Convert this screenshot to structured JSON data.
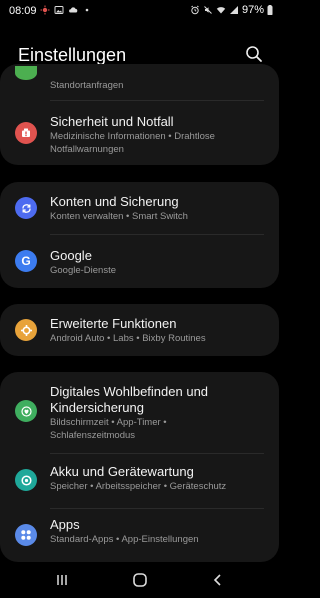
{
  "status_bar": {
    "time": "08:09",
    "battery": "97%"
  },
  "header": {
    "title": "Einstellungen"
  },
  "top_partial": {
    "subtitle": "Standortanfragen",
    "icon": "location-icon",
    "color": "#4caf50"
  },
  "items": [
    {
      "title": "Sicherheit und Notfall",
      "subtitle": "Medizinische Informationen  •  Drahtlose Notfallwarnungen",
      "icon": "emergency-icon",
      "color": "#e0534f"
    },
    {
      "title": "Konten und Sicherung",
      "subtitle": "Konten verwalten  •  Smart Switch",
      "icon": "sync-icon",
      "color": "#4d6bf0"
    },
    {
      "title": "Google",
      "subtitle": "Google-Dienste",
      "icon": "google-icon",
      "color": "#3c7cf0"
    },
    {
      "title": "Erweiterte Funktionen",
      "subtitle": "Android Auto  •  Labs  •  Bixby Routines",
      "icon": "gear-plus-icon",
      "color": "#e8a33a"
    },
    {
      "title": "Digitales Wohlbefinden und Kindersicherung",
      "subtitle": "Bildschirmzeit  •  App-Timer  •  Schlafenszeitmodus",
      "icon": "wellbeing-icon",
      "color": "#3fae5f"
    },
    {
      "title": "Akku und Gerätewartung",
      "subtitle": "Speicher  •  Arbeitsspeicher  •  Geräteschutz",
      "icon": "device-care-icon",
      "color": "#1fa89a"
    },
    {
      "title": "Apps",
      "subtitle": "Standard-Apps  •  App-Einstellungen",
      "icon": "apps-icon",
      "color": "#5a8ae8"
    }
  ],
  "nav": {
    "recents": "recents-icon",
    "home": "home-icon",
    "back": "back-icon"
  }
}
